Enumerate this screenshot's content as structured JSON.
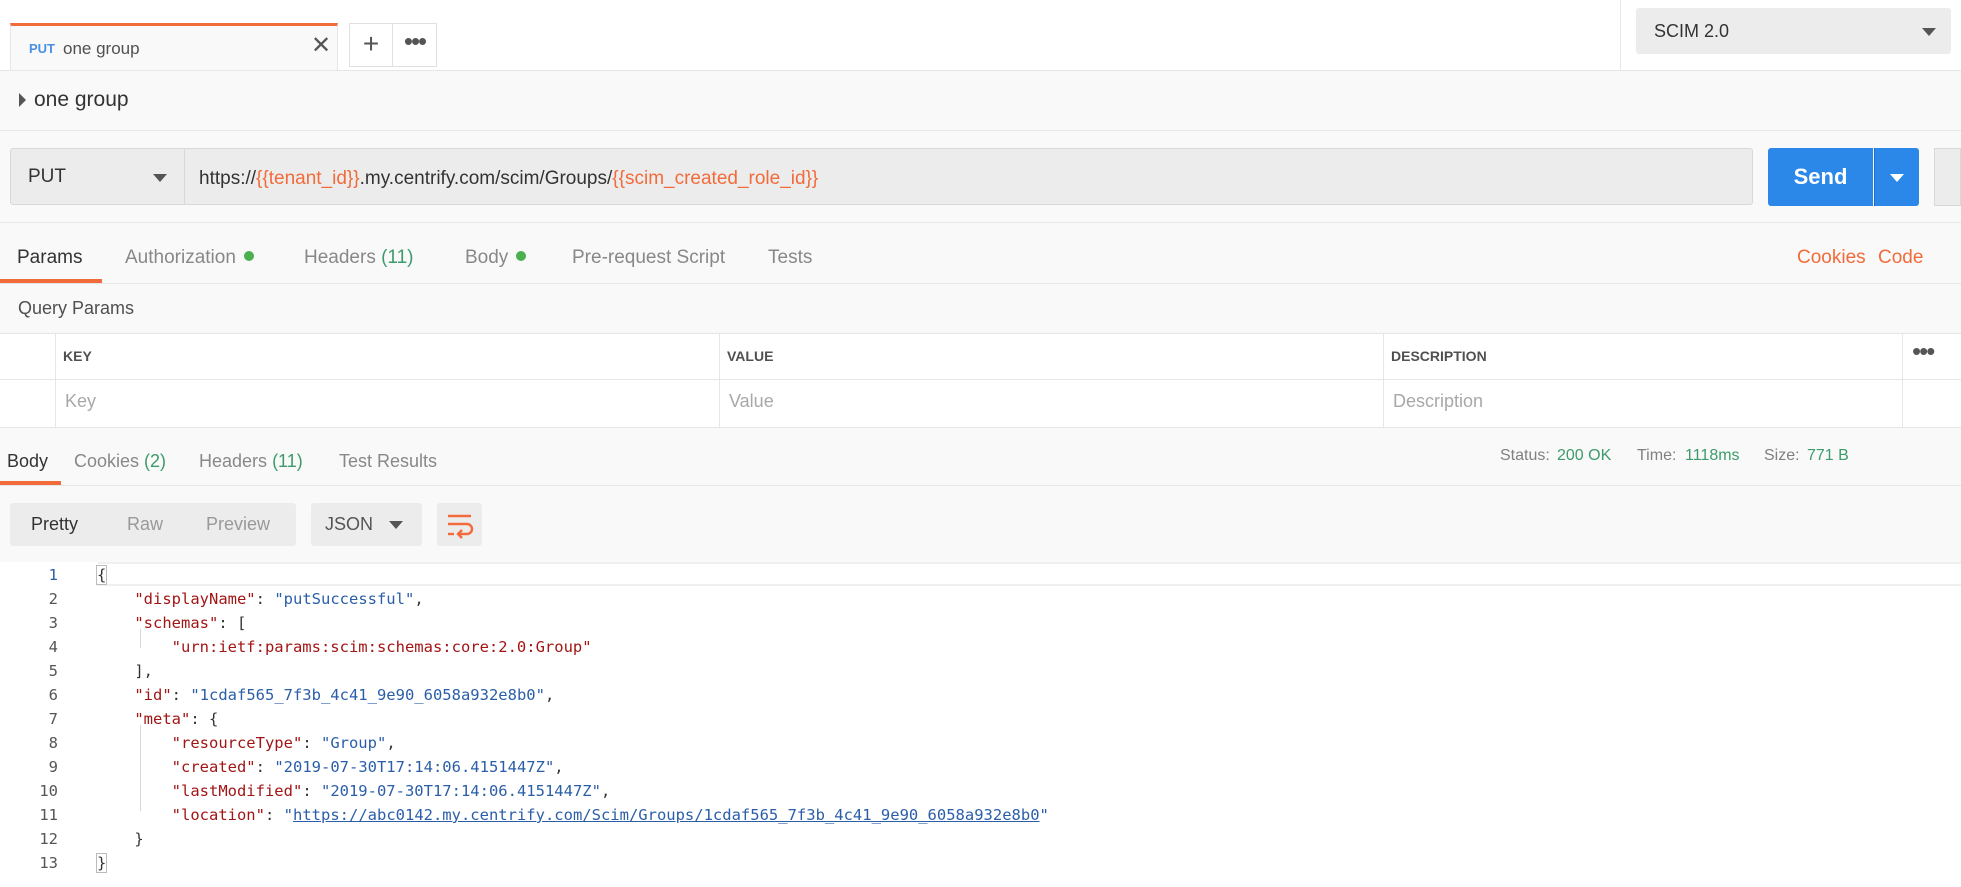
{
  "tab": {
    "method": "PUT",
    "name": "one group",
    "close": "✕"
  },
  "new_tab": "+",
  "more": "•••",
  "environment": {
    "selected": "SCIM 2.0"
  },
  "request_title": "one group",
  "method": "PUT",
  "url": {
    "prefix": "https://",
    "var1": "{{tenant_id}}",
    "middle": ".my.centrify.com/scim/Groups/",
    "var2": "{{scim_created_role_id}}"
  },
  "send_label": "Send",
  "request_tabs": {
    "params": "Params",
    "authorization": "Authorization",
    "headers": "Headers",
    "headers_count": "(11)",
    "body": "Body",
    "prerequest": "Pre-request Script",
    "tests": "Tests",
    "cookies": "Cookies",
    "code": "Code"
  },
  "query_params": {
    "title": "Query Params",
    "headers": [
      "KEY",
      "VALUE",
      "DESCRIPTION"
    ],
    "placeholders": [
      "Key",
      "Value",
      "Description"
    ]
  },
  "response_tabs": {
    "body": "Body",
    "cookies": "Cookies",
    "cookies_count": "(2)",
    "headers": "Headers",
    "headers_count": "(11)",
    "test_results": "Test Results"
  },
  "status": {
    "status_label": "Status:",
    "status_value": "200 OK",
    "time_label": "Time:",
    "time_value": "1118ms",
    "size_label": "Size:",
    "size_value": "771 B"
  },
  "view_modes": [
    "Pretty",
    "Raw",
    "Preview"
  ],
  "format": "JSON",
  "code": {
    "line_numbers": [
      "1",
      "2",
      "3",
      "4",
      "5",
      "6",
      "7",
      "8",
      "9",
      "10",
      "11",
      "12",
      "13"
    ],
    "displayName_key": "\"displayName\"",
    "displayName_val": "\"putSuccessful\"",
    "schemas_key": "\"schemas\"",
    "schema_val": "\"urn:ietf:params:scim:schemas:core:2.0:Group\"",
    "id_key": "\"id\"",
    "id_val": "\"1cdaf565_7f3b_4c41_9e90_6058a932e8b0\"",
    "meta_key": "\"meta\"",
    "resourceType_key": "\"resourceType\"",
    "resourceType_val": "\"Group\"",
    "created_key": "\"created\"",
    "created_val": "\"2019-07-30T17:14:06.4151447Z\"",
    "lastModified_key": "\"lastModified\"",
    "lastModified_val": "\"2019-07-30T17:14:06.4151447Z\"",
    "location_key": "\"location\"",
    "location_url": "https://abc0142.my.centrify.com/Scim/Groups/1cdaf565_7f3b_4c41_9e90_6058a932e8b0"
  }
}
